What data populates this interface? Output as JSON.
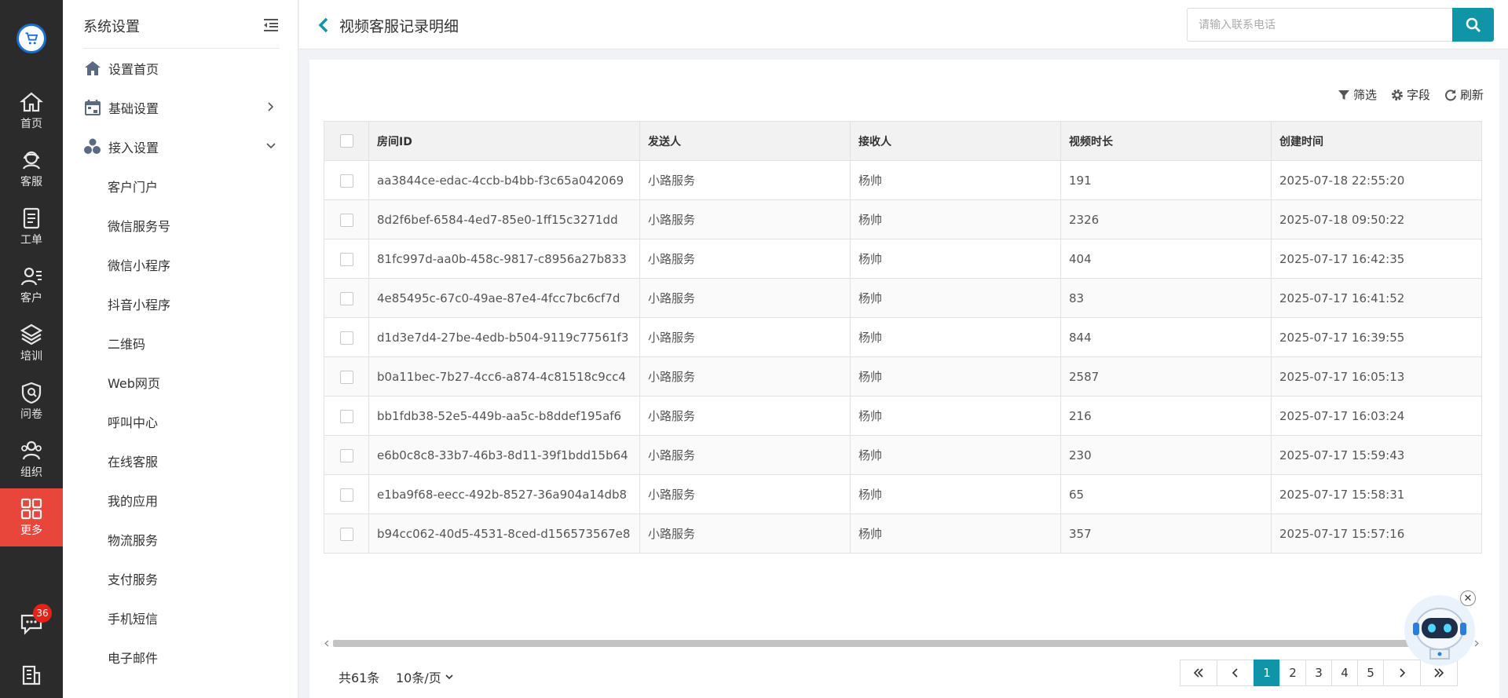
{
  "rail": {
    "items": [
      {
        "label": "首页",
        "icon": "home-icon"
      },
      {
        "label": "客服",
        "icon": "support-icon"
      },
      {
        "label": "工单",
        "icon": "ticket-icon"
      },
      {
        "label": "客户",
        "icon": "customer-icon"
      },
      {
        "label": "培训",
        "icon": "layers-icon"
      },
      {
        "label": "问卷",
        "icon": "shield-icon"
      },
      {
        "label": "组织",
        "icon": "group-icon"
      },
      {
        "label": "更多",
        "icon": "grid-icon",
        "active": true
      }
    ],
    "chat_badge": "36"
  },
  "sidebar": {
    "title": "系统设置",
    "items": [
      {
        "label": "设置首页",
        "icon": "home-icon"
      },
      {
        "label": "基础设置",
        "icon": "calendar-icon"
      },
      {
        "label": "接入设置",
        "icon": "users-icon"
      }
    ],
    "sub_items": [
      "客户门户",
      "微信服务号",
      "微信小程序",
      "抖音小程序",
      "二维码",
      "Web网页",
      "呼叫中心",
      "在线客服",
      "我的应用",
      "物流服务",
      "支付服务",
      "手机短信",
      "电子邮件"
    ]
  },
  "header": {
    "title": "视频客服记录明细",
    "search_placeholder": "请输入联系电话"
  },
  "toolbar": {
    "filter": "筛选",
    "fields": "字段",
    "refresh": "刷新"
  },
  "table": {
    "columns": [
      "房间ID",
      "发送人",
      "接收人",
      "视频时长",
      "创建时间"
    ],
    "rows": [
      [
        "aa3844ce-edac-4ccb-b4bb-f3c65a042069",
        "小路服务",
        "杨帅",
        "191",
        "2025-07-18 22:55:20"
      ],
      [
        "8d2f6bef-6584-4ed7-85e0-1ff15c3271dd",
        "小路服务",
        "杨帅",
        "2326",
        "2025-07-18 09:50:22"
      ],
      [
        "81fc997d-aa0b-458c-9817-c8956a27b833",
        "小路服务",
        "杨帅",
        "404",
        "2025-07-17 16:42:35"
      ],
      [
        "4e85495c-67c0-49ae-87e4-4fcc7bc6cf7d",
        "小路服务",
        "杨帅",
        "83",
        "2025-07-17 16:41:52"
      ],
      [
        "d1d3e7d4-27be-4edb-b504-9119c77561f3",
        "小路服务",
        "杨帅",
        "844",
        "2025-07-17 16:39:55"
      ],
      [
        "b0a11bec-7b27-4cc6-a874-4c81518c9cc4",
        "小路服务",
        "杨帅",
        "2587",
        "2025-07-17 16:05:13"
      ],
      [
        "bb1fdb38-52e5-449b-aa5c-b8ddef195af6",
        "小路服务",
        "杨帅",
        "216",
        "2025-07-17 16:03:24"
      ],
      [
        "e6b0c8c8-33b7-46b3-8d11-39f1bdd15b64",
        "小路服务",
        "杨帅",
        "230",
        "2025-07-17 15:59:43"
      ],
      [
        "e1ba9f68-eecc-492b-8527-36a904a14db8",
        "小路服务",
        "杨帅",
        "65",
        "2025-07-17 15:58:31"
      ],
      [
        "b94cc062-40d5-4531-8ced-d156573567e8",
        "小路服务",
        "杨帅",
        "357",
        "2025-07-17 15:57:16"
      ]
    ]
  },
  "footer": {
    "total": "共61条",
    "page_size": "10条/页",
    "pages": [
      "1",
      "2",
      "3",
      "4",
      "5"
    ],
    "current_page": "1"
  },
  "colors": {
    "accent": "#1095a8",
    "active_rail": "#e8463a",
    "rail_bg": "#2b2b2b",
    "badge": "#e62117"
  }
}
